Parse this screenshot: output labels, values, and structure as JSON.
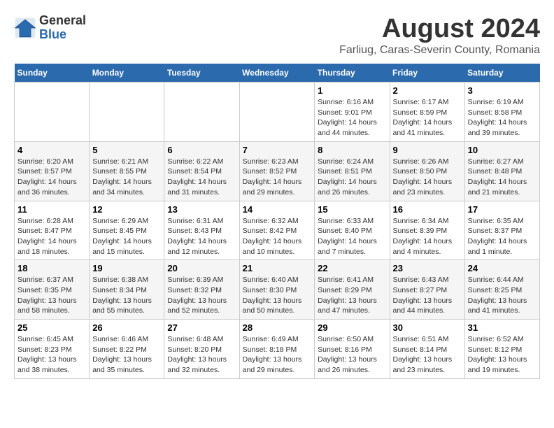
{
  "logo": {
    "general": "General",
    "blue": "Blue"
  },
  "title": "August 2024",
  "subtitle": "Farliug, Caras-Severin County, Romania",
  "days_of_week": [
    "Sunday",
    "Monday",
    "Tuesday",
    "Wednesday",
    "Thursday",
    "Friday",
    "Saturday"
  ],
  "weeks": [
    [
      {
        "day": "",
        "info": ""
      },
      {
        "day": "",
        "info": ""
      },
      {
        "day": "",
        "info": ""
      },
      {
        "day": "",
        "info": ""
      },
      {
        "day": "1",
        "info": "Sunrise: 6:16 AM\nSunset: 9:01 PM\nDaylight: 14 hours and 44 minutes."
      },
      {
        "day": "2",
        "info": "Sunrise: 6:17 AM\nSunset: 8:59 PM\nDaylight: 14 hours and 41 minutes."
      },
      {
        "day": "3",
        "info": "Sunrise: 6:19 AM\nSunset: 8:58 PM\nDaylight: 14 hours and 39 minutes."
      }
    ],
    [
      {
        "day": "4",
        "info": "Sunrise: 6:20 AM\nSunset: 8:57 PM\nDaylight: 14 hours and 36 minutes."
      },
      {
        "day": "5",
        "info": "Sunrise: 6:21 AM\nSunset: 8:55 PM\nDaylight: 14 hours and 34 minutes."
      },
      {
        "day": "6",
        "info": "Sunrise: 6:22 AM\nSunset: 8:54 PM\nDaylight: 14 hours and 31 minutes."
      },
      {
        "day": "7",
        "info": "Sunrise: 6:23 AM\nSunset: 8:52 PM\nDaylight: 14 hours and 29 minutes."
      },
      {
        "day": "8",
        "info": "Sunrise: 6:24 AM\nSunset: 8:51 PM\nDaylight: 14 hours and 26 minutes."
      },
      {
        "day": "9",
        "info": "Sunrise: 6:26 AM\nSunset: 8:50 PM\nDaylight: 14 hours and 23 minutes."
      },
      {
        "day": "10",
        "info": "Sunrise: 6:27 AM\nSunset: 8:48 PM\nDaylight: 14 hours and 21 minutes."
      }
    ],
    [
      {
        "day": "11",
        "info": "Sunrise: 6:28 AM\nSunset: 8:47 PM\nDaylight: 14 hours and 18 minutes."
      },
      {
        "day": "12",
        "info": "Sunrise: 6:29 AM\nSunset: 8:45 PM\nDaylight: 14 hours and 15 minutes."
      },
      {
        "day": "13",
        "info": "Sunrise: 6:31 AM\nSunset: 8:43 PM\nDaylight: 14 hours and 12 minutes."
      },
      {
        "day": "14",
        "info": "Sunrise: 6:32 AM\nSunset: 8:42 PM\nDaylight: 14 hours and 10 minutes."
      },
      {
        "day": "15",
        "info": "Sunrise: 6:33 AM\nSunset: 8:40 PM\nDaylight: 14 hours and 7 minutes."
      },
      {
        "day": "16",
        "info": "Sunrise: 6:34 AM\nSunset: 8:39 PM\nDaylight: 14 hours and 4 minutes."
      },
      {
        "day": "17",
        "info": "Sunrise: 6:35 AM\nSunset: 8:37 PM\nDaylight: 14 hours and 1 minute."
      }
    ],
    [
      {
        "day": "18",
        "info": "Sunrise: 6:37 AM\nSunset: 8:35 PM\nDaylight: 13 hours and 58 minutes."
      },
      {
        "day": "19",
        "info": "Sunrise: 6:38 AM\nSunset: 8:34 PM\nDaylight: 13 hours and 55 minutes."
      },
      {
        "day": "20",
        "info": "Sunrise: 6:39 AM\nSunset: 8:32 PM\nDaylight: 13 hours and 52 minutes."
      },
      {
        "day": "21",
        "info": "Sunrise: 6:40 AM\nSunset: 8:30 PM\nDaylight: 13 hours and 50 minutes."
      },
      {
        "day": "22",
        "info": "Sunrise: 6:41 AM\nSunset: 8:29 PM\nDaylight: 13 hours and 47 minutes."
      },
      {
        "day": "23",
        "info": "Sunrise: 6:43 AM\nSunset: 8:27 PM\nDaylight: 13 hours and 44 minutes."
      },
      {
        "day": "24",
        "info": "Sunrise: 6:44 AM\nSunset: 8:25 PM\nDaylight: 13 hours and 41 minutes."
      }
    ],
    [
      {
        "day": "25",
        "info": "Sunrise: 6:45 AM\nSunset: 8:23 PM\nDaylight: 13 hours and 38 minutes."
      },
      {
        "day": "26",
        "info": "Sunrise: 6:46 AM\nSunset: 8:22 PM\nDaylight: 13 hours and 35 minutes."
      },
      {
        "day": "27",
        "info": "Sunrise: 6:48 AM\nSunset: 8:20 PM\nDaylight: 13 hours and 32 minutes."
      },
      {
        "day": "28",
        "info": "Sunrise: 6:49 AM\nSunset: 8:18 PM\nDaylight: 13 hours and 29 minutes."
      },
      {
        "day": "29",
        "info": "Sunrise: 6:50 AM\nSunset: 8:16 PM\nDaylight: 13 hours and 26 minutes."
      },
      {
        "day": "30",
        "info": "Sunrise: 6:51 AM\nSunset: 8:14 PM\nDaylight: 13 hours and 23 minutes."
      },
      {
        "day": "31",
        "info": "Sunrise: 6:52 AM\nSunset: 8:12 PM\nDaylight: 13 hours and 19 minutes."
      }
    ]
  ]
}
